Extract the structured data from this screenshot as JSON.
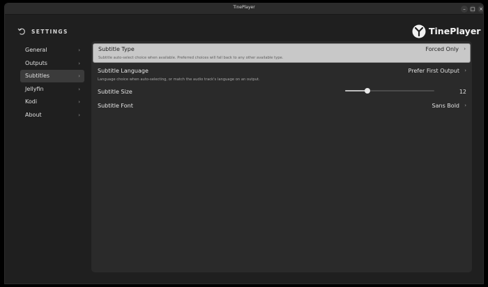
{
  "window": {
    "title": "TinePlayer",
    "controls": {
      "minimize": "–",
      "maximize": "□",
      "close": "×"
    }
  },
  "header": {
    "back_icon": "back-arrow-icon",
    "title": "SETTINGS",
    "logo_text": "TinePlayer",
    "logo_icon": "tineplayer-logo-icon"
  },
  "sidebar": {
    "items": [
      {
        "label": "General",
        "active": false
      },
      {
        "label": "Outputs",
        "active": false
      },
      {
        "label": "Subtitles",
        "active": true
      },
      {
        "label": "Jellyfin",
        "active": false
      },
      {
        "label": "Kodi",
        "active": false
      },
      {
        "label": "About",
        "active": false
      }
    ],
    "chevron": "›"
  },
  "settings": {
    "subtitle_type": {
      "label": "Subtitle Type",
      "description": "Subtitle auto-select choice when available. Preferred choices will fall back to any other available type.",
      "value": "Forced Only"
    },
    "subtitle_language": {
      "label": "Subtitle Language",
      "description": "Language choice when auto-selecting, or match the audio track's language on an output.",
      "value": "Prefer First Output"
    },
    "subtitle_size": {
      "label": "Subtitle Size",
      "value": "12",
      "slider_fraction": 0.25
    },
    "subtitle_font": {
      "label": "Subtitle Font",
      "value": "Sans Bold"
    },
    "chevron": "›"
  },
  "colors": {
    "background": "#1f1f1f",
    "panel": "#2a2a2a",
    "selected_row": "#c8c8c8",
    "active_sidebar": "#3b3b3b"
  }
}
